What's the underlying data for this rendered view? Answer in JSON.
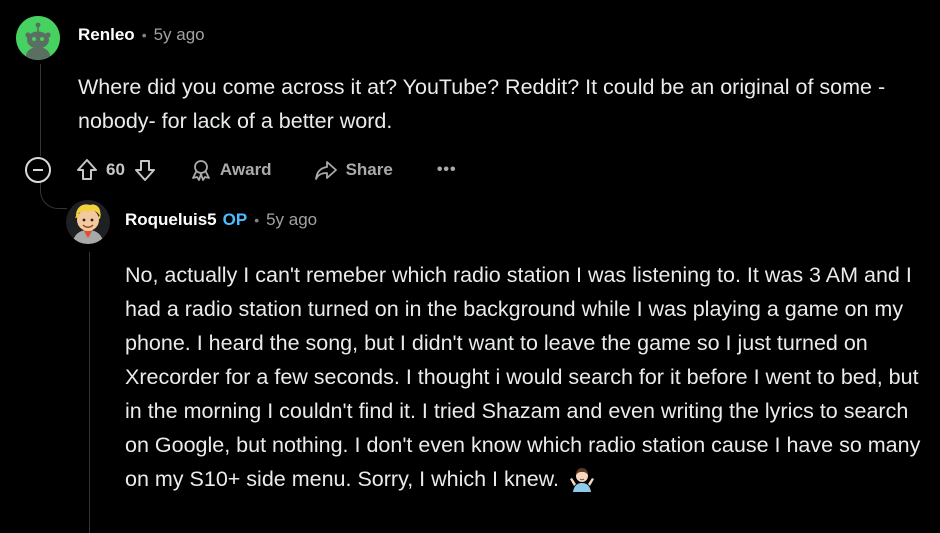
{
  "comment": {
    "author": "Renleo",
    "separator": "•",
    "time": "5y ago",
    "body": "Where did you come across it at? YouTube? Reddit? It could be an original of some -nobody- for lack of a better word.",
    "score": "60",
    "award_label": "Award",
    "share_label": "Share",
    "more_label": "•••",
    "avatar_color": "#46d160"
  },
  "reply": {
    "author": "Roqueluis5",
    "op_badge": "OP",
    "separator": "•",
    "time": "5y ago",
    "body": "No, actually I can't remeber which radio station I was listening to. It was 3 AM and I had a radio station turned on in the background while I was playing a game on my phone. I heard the song, but I didn't want to leave the game so I just turned on Xrecorder for a few seconds. I thought i would search for it before I went to bed, but in the morning I couldn't find it. I tried Shazam and even writing the lyrics to search on Google, but nothing. I don't even know which radio station cause I have so many on my S10+ side menu. Sorry, I which I knew.",
    "emoji": "person-shrugging-emoji",
    "op_color": "#4fbcff"
  },
  "colors": {
    "background": "#000000",
    "text": "#e9ebec",
    "meta": "#a0a3a5"
  }
}
